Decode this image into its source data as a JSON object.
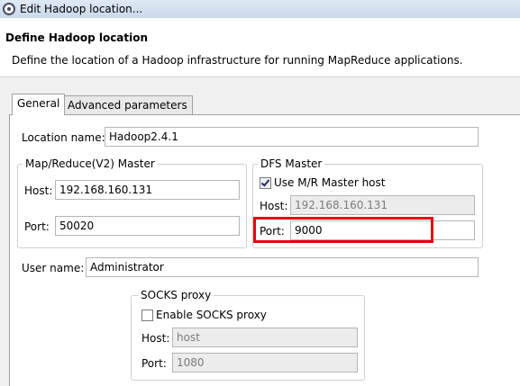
{
  "window": {
    "title": "Edit Hadoop location..."
  },
  "header": {
    "title": "Define Hadoop location",
    "description": "Define the location of a Hadoop infrastructure for running MapReduce applications."
  },
  "tabs": [
    {
      "label": "General",
      "active": true
    },
    {
      "label": "Advanced parameters",
      "active": false
    }
  ],
  "general": {
    "location_name_label": "Location name:",
    "location_name_value": "Hadoop2.4.1",
    "mapreduce": {
      "legend": "Map/Reduce(V2) Master",
      "host_label": "Host:",
      "host_value": "192.168.160.131",
      "port_label": "Port:",
      "port_value": "50020"
    },
    "dfs": {
      "legend": "DFS Master",
      "use_mr_label": "Use M/R Master host",
      "use_mr_checked": true,
      "host_label": "Host:",
      "host_value": "192.168.160.131",
      "port_label": "Port:",
      "port_value": "9000"
    },
    "user_name_label": "User name:",
    "user_name_value": "Administrator",
    "socks": {
      "legend": "SOCKS proxy",
      "enable_label": "Enable SOCKS proxy",
      "enable_checked": false,
      "host_label": "Host:",
      "host_value": "host",
      "port_label": "Port:",
      "port_value": "1080"
    }
  },
  "colors": {
    "highlight": "#e50012",
    "panel_background": "#ffffff",
    "dialog_background": "#f0f0f0"
  }
}
